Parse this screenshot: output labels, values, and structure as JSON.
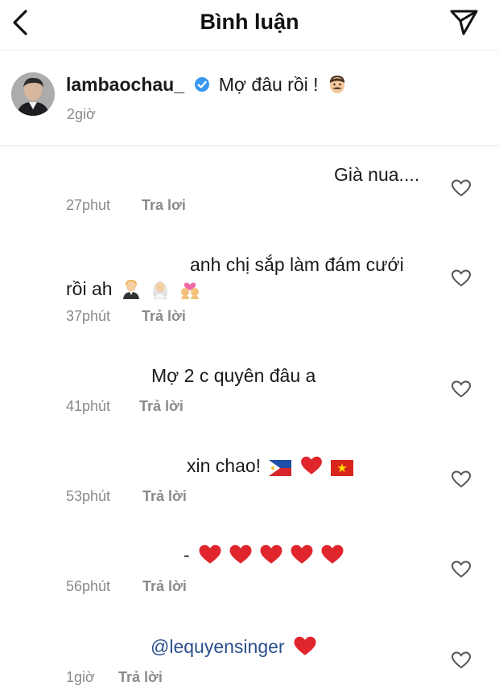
{
  "header": {
    "title": "Bình luận",
    "back_icon": "chevron-left-icon",
    "send_icon": "paper-plane-icon"
  },
  "post": {
    "username": "lambaochau_",
    "caption": "Mợ đâu rồi !",
    "time": "2giờ"
  },
  "comments": [
    {
      "text": "Già nua....",
      "time": "27phut",
      "reply": "Tra lơi"
    },
    {
      "text_line1": "anh chị sắp làm đám cưới",
      "text_line2": "rồi ah",
      "time": "37phút",
      "reply": "Trả lời"
    },
    {
      "text": "Mợ 2 c quyên đâu a",
      "time": "41phút",
      "reply": "Trả lời"
    },
    {
      "text": "xin chao!",
      "time": "53phút",
      "reply": "Trả lời"
    },
    {
      "text": "-",
      "time": "56phút",
      "reply": "Trả lời"
    },
    {
      "mention": "@lequyensinger",
      "time": "1giờ",
      "reply": "Trả lời"
    }
  ],
  "colors": {
    "heart_red": "#e0252d",
    "muted_text": "#8a8a8a",
    "verified_blue": "#3897f0"
  }
}
